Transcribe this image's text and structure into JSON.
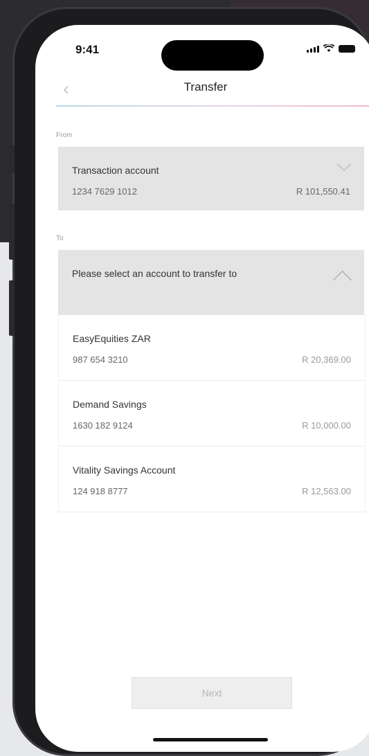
{
  "status_bar": {
    "time": "9:41"
  },
  "nav": {
    "back_icon": "chevron-left-icon",
    "title": "Transfer"
  },
  "from": {
    "label": "From",
    "account_name": "Transaction account",
    "account_number": "1234 7629 1012",
    "balance": "R 101,550.41"
  },
  "to": {
    "label": "To",
    "placeholder": "Please select an account to transfer to",
    "accounts": [
      {
        "name": "EasyEquities ZAR",
        "number": "987 654 3210",
        "balance": "R 20,369.00"
      },
      {
        "name": "Demand Savings",
        "number": "1630 182 9124",
        "balance": "R 10,000.00"
      },
      {
        "name": "Vitality Savings Account",
        "number": "124 918 8777",
        "balance": "R 12,563.00"
      }
    ]
  },
  "next_button": {
    "label": "Next"
  },
  "colors": {
    "card_bg": "#e4e4e4",
    "accent_gradient": [
      "#b6d8e8",
      "#f1b8c8"
    ],
    "disabled_text": "#b5b5b5"
  }
}
